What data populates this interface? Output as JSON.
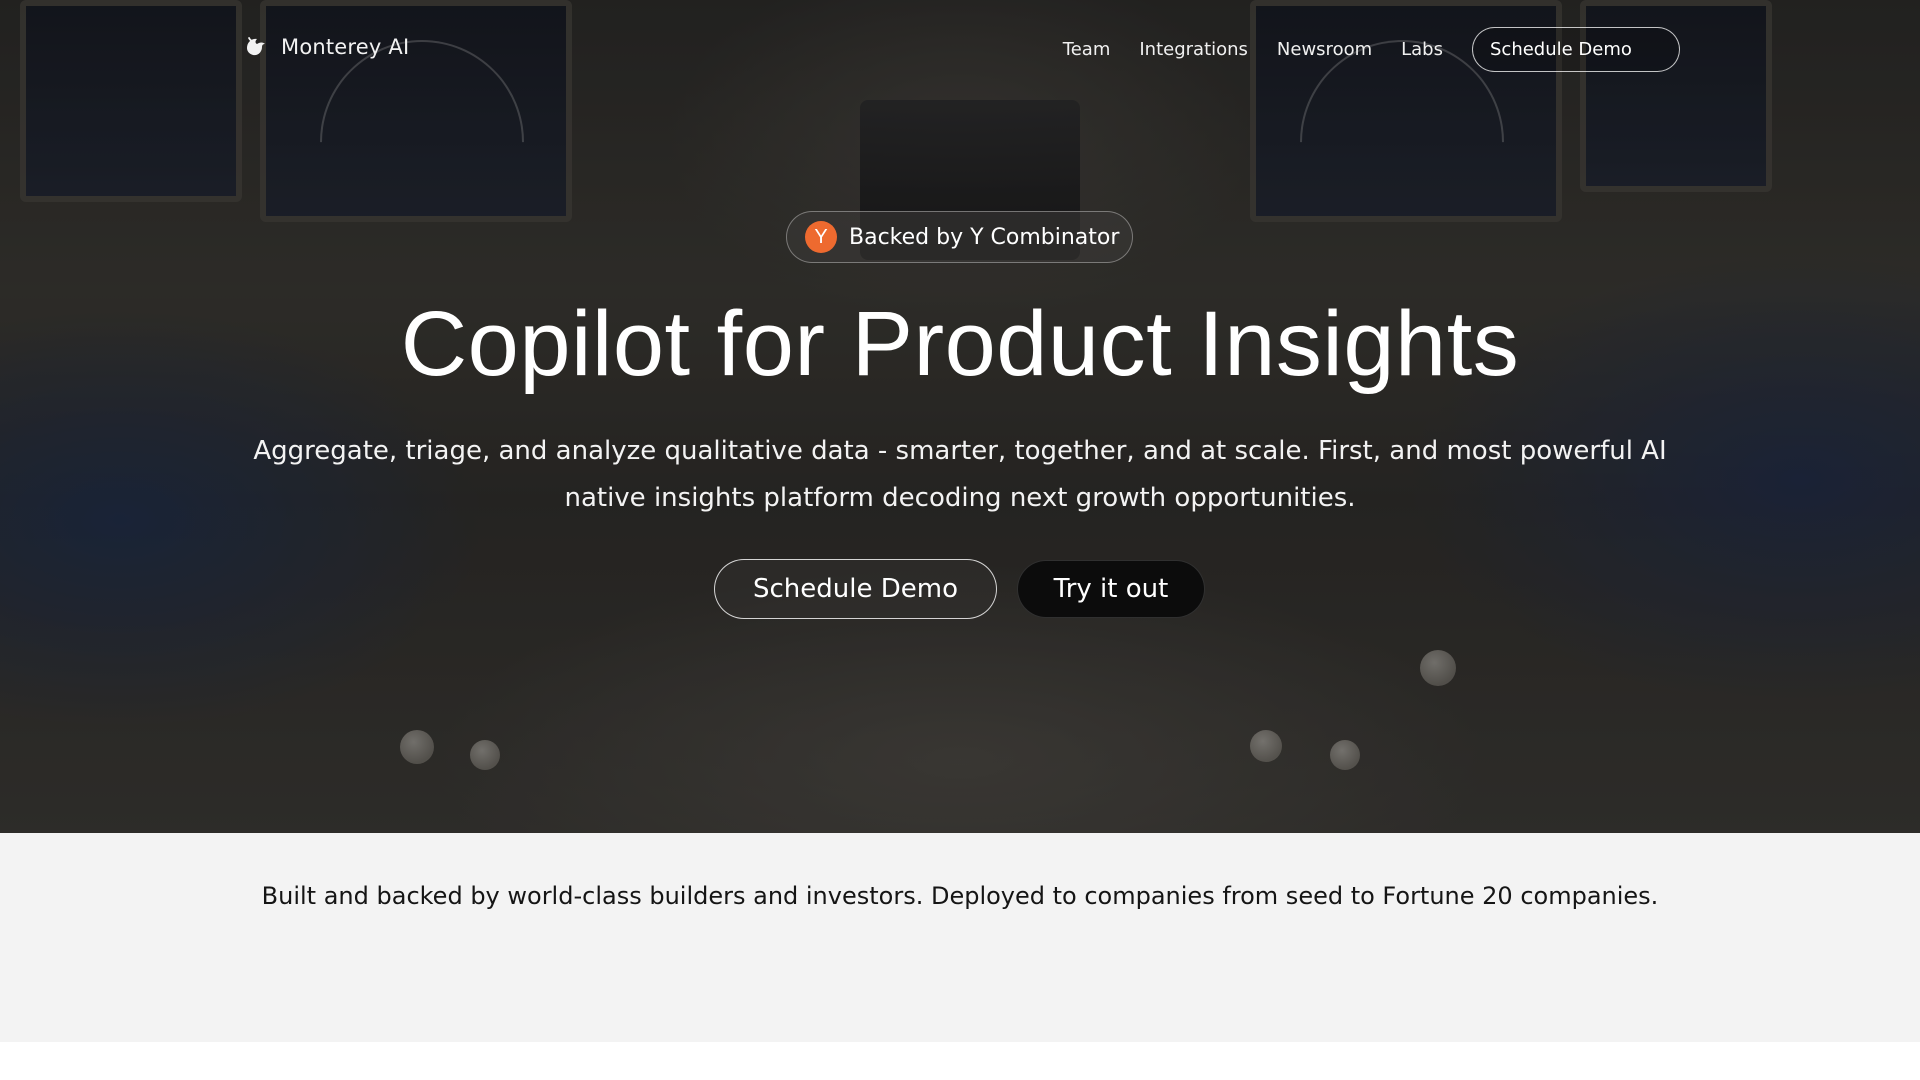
{
  "brand": {
    "name": "Monterey AI",
    "logo_icon": "bird-logo-icon"
  },
  "nav": {
    "links": [
      "Team",
      "Integrations",
      "Newsroom",
      "Labs"
    ],
    "cta_label": "Schedule Demo"
  },
  "hero": {
    "badge": {
      "icon_letter": "Y",
      "icon_color": "#ee6a2f",
      "text": "Backed by Y Combinator"
    },
    "title": "Copilot for Product Insights",
    "subtitle": "Aggregate, triage, and analyze qualitative data - smarter, together, and at scale. First, and most powerful AI native insights platform decoding next growth opportunities.",
    "primary_button": "Schedule Demo",
    "secondary_button": "Try it out"
  },
  "social_proof": {
    "text": "Built and backed by world-class builders and investors. Deployed to companies from seed to Fortune 20 companies."
  }
}
